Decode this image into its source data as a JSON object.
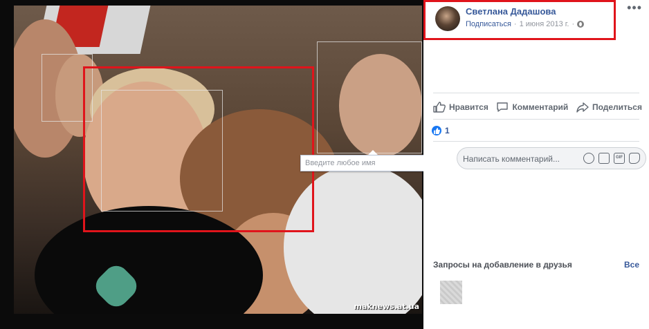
{
  "viewer": {
    "watermark": "maknews.at.ua",
    "tag_input_placeholder": "Введите любое имя"
  },
  "post": {
    "author": "Светлана Дадашова",
    "subscribe": "Подписаться",
    "separator": "·",
    "date": "1 июня 2013 г.",
    "more_icon": "more-dots-icon"
  },
  "actions": {
    "like": "Нравится",
    "comment": "Комментарий",
    "share": "Поделиться"
  },
  "reactions": {
    "count": "1"
  },
  "comment": {
    "placeholder": "Написать комментарий..."
  },
  "friend_requests": {
    "title": "Запросы на добавление в друзья",
    "see_all": "Все"
  },
  "colors": {
    "highlight": "#e0141b",
    "link": "#365899",
    "like": "#1877f2"
  }
}
